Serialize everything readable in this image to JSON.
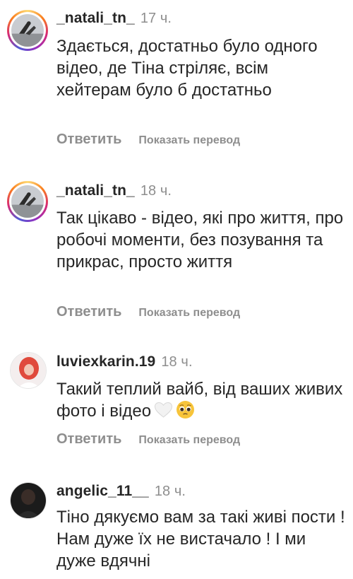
{
  "comments": [
    {
      "username": "_natali_tn_",
      "time": "17 ч.",
      "text": "Здається, достатньо було одного відео, де Тіна стріляє, всім хейтерам було б достатньо",
      "reply_label": "Ответить",
      "translate_label": "Показать перевод"
    },
    {
      "username": "_natali_tn_",
      "time": "18 ч.",
      "text": "Так цікаво - відео, які про життя, про робочі моменти, без позування та прикрас, просто життя",
      "reply_label": "Ответить",
      "translate_label": "Показать перевод"
    },
    {
      "username": "luviexkarin.19",
      "time": "18 ч.",
      "text": "Такий теплий вайб, від ваших живих фото і відео",
      "emoji": [
        "white-heart-icon",
        "pleading-face-icon"
      ],
      "reply_label": "Ответить",
      "translate_label": "Показать перевод"
    },
    {
      "username": "angelic_11__",
      "time": "18 ч.",
      "text": "Тіно дякуємо вам за такі живі пости ! Нам дуже їх не вистачало ! І ми дуже вдячні"
    }
  ],
  "colors": {
    "text": "#262626",
    "muted": "#8e8e8e",
    "background": "#ffffff"
  }
}
